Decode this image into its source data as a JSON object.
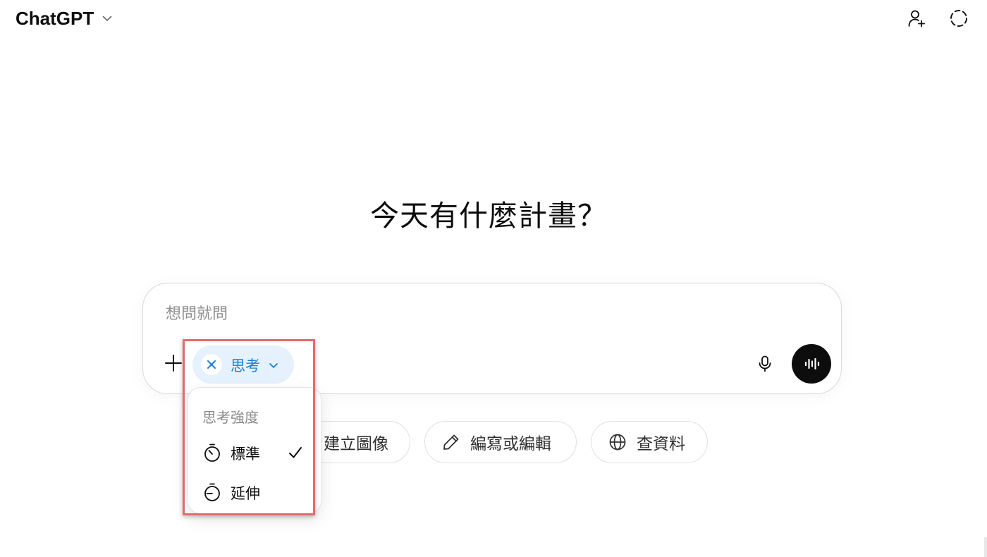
{
  "header": {
    "app_title": "ChatGPT",
    "icons": {
      "model_menu": "chevron-down-icon",
      "share": "add-person-icon",
      "temporary_chat": "dashed-circle-icon"
    }
  },
  "main": {
    "heading": "今天有什麼計畫？"
  },
  "composer": {
    "placeholder": "想問就問",
    "value": "",
    "think_chip": {
      "label": "思考",
      "color": "#1a7fd6",
      "background": "#e5f1fc"
    },
    "icons": {
      "add": "plus-icon",
      "remove_chip": "close-icon",
      "dictate": "microphone-icon",
      "voice_mode": "waveform-icon"
    }
  },
  "suggestions": [
    {
      "label": "建立圖像",
      "icon": "image-icon"
    },
    {
      "label": "編寫或編輯",
      "icon": "pencil-icon"
    },
    {
      "label": "查資料",
      "icon": "globe-icon"
    }
  ],
  "think_menu": {
    "heading": "思考強度",
    "items": [
      {
        "label": "標準",
        "icon": "timer-icon",
        "selected": true
      },
      {
        "label": "延伸",
        "icon": "timer-extended-icon",
        "selected": false
      }
    ]
  },
  "annotation": {
    "highlight_color": "#e46a6a"
  }
}
